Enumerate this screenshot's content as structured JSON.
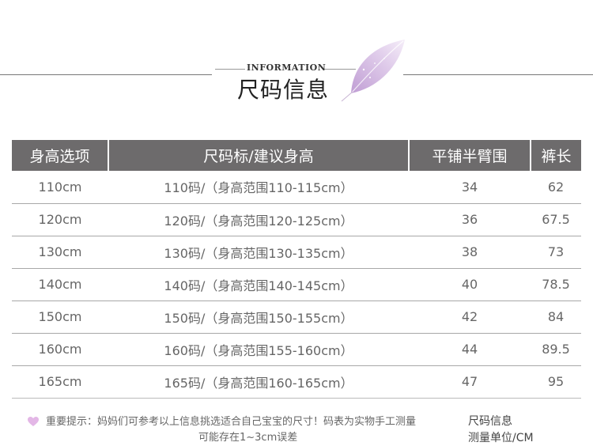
{
  "header": {
    "info_label": "INFORMATION",
    "title": "尺码信息"
  },
  "table": {
    "columns": [
      "身高选项",
      "尺码标/建议身高",
      "平铺半臂围",
      "裤长"
    ],
    "rows": [
      [
        "110cm",
        "110码/（身高范围110-115cm）",
        "34",
        "62"
      ],
      [
        "120cm",
        "120码/（身高范围120-125cm）",
        "36",
        "67.5"
      ],
      [
        "130cm",
        "130码/（身高范围130-135cm）",
        "38",
        "73"
      ],
      [
        "140cm",
        "140码/（身高范围140-145cm）",
        "40",
        "78.5"
      ],
      [
        "150cm",
        "150码/（身高范围150-155cm）",
        "42",
        "84"
      ],
      [
        "160cm",
        "160码/（身高范围155-160cm）",
        "44",
        "89.5"
      ],
      [
        "165cm",
        "165码/（身高范围160-165cm）",
        "47",
        "95"
      ]
    ]
  },
  "footer": {
    "note_line1": "重要提示：妈妈们可参考以上信息挑选适合自己宝宝的尺寸！码表为实物手工测量",
    "note_line2": "可能存在1~3cm误差",
    "right_line1": "尺码信息",
    "right_line2": "测量单位/CM"
  },
  "colors": {
    "header_bg": "#6d6b6c",
    "accent_leaf": "#c9a8d8",
    "heart": "#e3b7e6"
  },
  "icons": {
    "leaf": "leaf-icon",
    "heart": "heart-icon"
  }
}
